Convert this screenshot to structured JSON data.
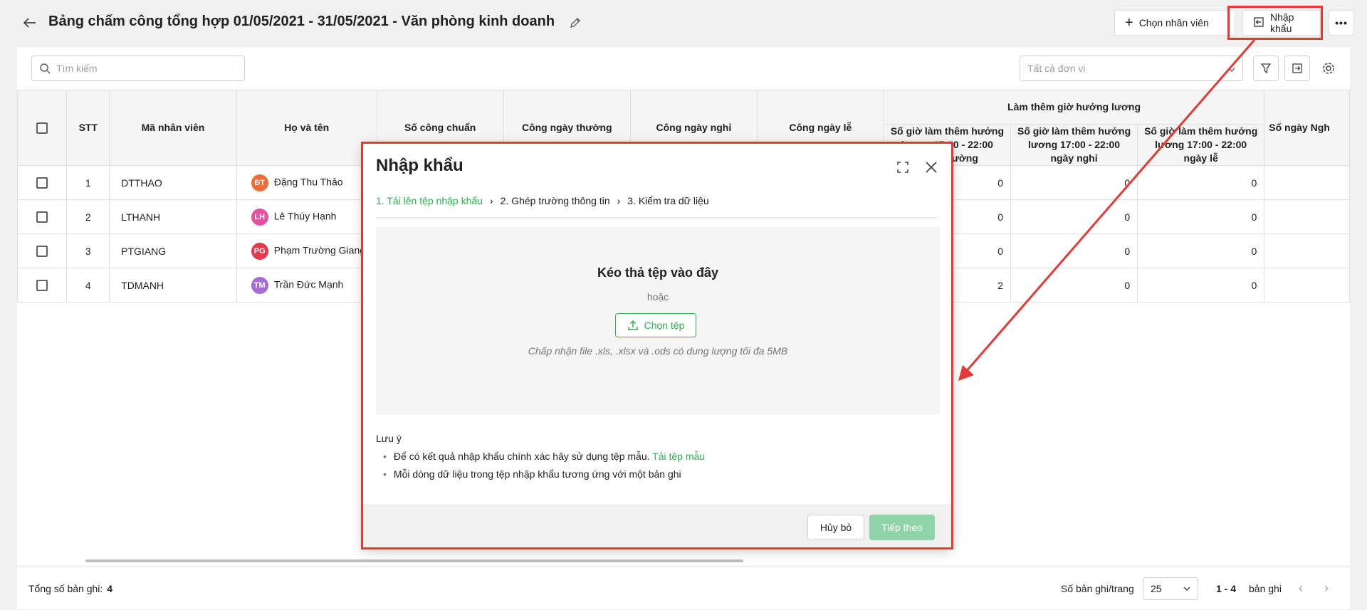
{
  "header": {
    "title": "Bảng chấm công tổng hợp 01/05/2021 - 31/05/2021 - Văn phòng kinh doanh",
    "choose_employee": "Chọn nhân viên",
    "import": "Nhập khẩu"
  },
  "toolbar": {
    "search_placeholder": "Tìm kiếm",
    "unit_placeholder": "Tất cả đơn vị"
  },
  "table": {
    "columns": {
      "stt": "STT",
      "code": "Mã nhân viên",
      "name": "Họ và tên",
      "standard": "Số công chuẩn",
      "weekday": "Công ngày thường",
      "dayoff": "Công ngày nghỉ",
      "holiday": "Công ngày lễ",
      "overtime_group": "Làm thêm giờ hưởng lương",
      "ot_weekday": "Số giờ làm thêm hưởng lương 17:00 - 22:00 ngày thường",
      "ot_dayoff": "Số giờ làm thêm hưởng lương 17:00 - 22:00 ngày nghỉ",
      "ot_holiday": "Số giờ làm thêm hưởng lương 17:00 - 22:00 ngày lễ",
      "days": "Số ngày Ngh"
    },
    "rows": [
      {
        "stt": "1",
        "code": "DTTHAO",
        "initials": "ĐT",
        "name": "Đặng Thu Thảo",
        "avatar_color": "#ef6c3a",
        "ot_weekday": "0",
        "ot_dayoff": "0",
        "ot_holiday": "0"
      },
      {
        "stt": "2",
        "code": "LTHANH",
        "initials": "LH",
        "name": "Lê Thúy Hạnh",
        "avatar_color": "#e64fa0",
        "ot_weekday": "0",
        "ot_dayoff": "0",
        "ot_holiday": "0"
      },
      {
        "stt": "3",
        "code": "PTGIANG",
        "initials": "PG",
        "name": "Phạm Trường Giang",
        "avatar_color": "#e53950",
        "ot_weekday": "0",
        "ot_dayoff": "0",
        "ot_holiday": "0"
      },
      {
        "stt": "4",
        "code": "TDMANH",
        "initials": "TM",
        "name": "Trần Đức Mạnh",
        "avatar_color": "#a56bd6",
        "ot_weekday": "2",
        "ot_dayoff": "0",
        "ot_holiday": "0"
      }
    ]
  },
  "footer": {
    "total_label": "Tổng số bản ghi:",
    "total_value": "4",
    "per_page_label": "Số bản ghi/trang",
    "per_page_value": "25",
    "range_value": "1 - 4",
    "range_suffix": "bản ghi"
  },
  "modal": {
    "title": "Nhập khẩu",
    "steps": [
      "1. Tải lên tệp nhập khẩu",
      "2. Ghép trường thông tin",
      "3. Kiểm tra dữ liệu"
    ],
    "drop_title": "Kéo thả tệp vào đây",
    "drop_or": "hoặc",
    "choose_file": "Chọn tệp",
    "accept_hint": "Chấp nhận file .xls, .xlsx và .ods có dung lượng tối đa 5MB",
    "note_title": "Lưu ý",
    "note_1": "Để có kết quả nhập khẩu chính xác hãy sử dụng tệp mẫu.",
    "note_1_link": "Tải tệp mẫu",
    "note_2": "Mỗi dòng dữ liệu trong tệp nhập khẩu tương ứng với một bản ghi",
    "cancel": "Hủy bỏ",
    "next": "Tiếp theo"
  },
  "colors": {
    "accent_green": "#2bb24c",
    "next_disabled": "#8fd4a6",
    "highlight_red": "#e53935"
  }
}
